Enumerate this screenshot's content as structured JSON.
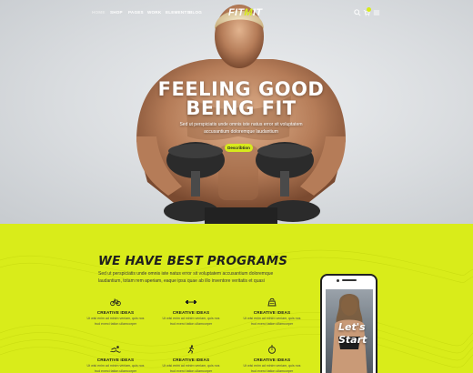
{
  "nav": {
    "links": [
      "HOME",
      "SHOP",
      "PAGES",
      "WORK",
      "ELEMENTS",
      "BLOG"
    ],
    "logo_main": "FIT",
    "logo_accent": "M",
    "logo_end": "IT"
  },
  "hero": {
    "title_line1": "FEELING GOOD",
    "title_line2": "BEING FIT",
    "subtitle": "Sed ut perspiciatis unde omnis iste natus error sit voluptatem accusantium doloremque laudantium",
    "button": "Describtion"
  },
  "programs": {
    "title": "WE HAVE BEST PROGRAMS",
    "description": "Sed ut perspiciatis unde omnis iste natus error sit voluptatem accusantium doloremque laudantium, totam rem aperiam, eaque ipsa quae ab illo inventore veritatis et quasi",
    "features": [
      {
        "icon": "bicycle-icon",
        "title": "CREATIVE IDEAS",
        "text": "Ut wisi enim ad minim veniam, quis nos trud exerci tation ullamcorper"
      },
      {
        "icon": "dumbbell-icon",
        "title": "CREATIVE IDEAS",
        "text": "Ut wisi enim ad minim veniam, quis nos trud exerci tation ullamcorper"
      },
      {
        "icon": "kettlebell-icon",
        "title": "CREATIVE IDEAS",
        "text": "Ut wisi enim ad minim veniam, quis nos trud exerci tation ullamcorper"
      },
      {
        "icon": "swimming-icon",
        "title": "CREATIVE IDEAS",
        "text": "Ut wisi enim ad minim veniam, quis nos trud exerci tation ullamcorper"
      },
      {
        "icon": "running-icon",
        "title": "CREATIVE IDEAS",
        "text": "Ut wisi enim ad minim veniam, quis nos trud exerci tation ullamcorper"
      },
      {
        "icon": "stopwatch-icon",
        "title": "CREATIVE IDEAS",
        "text": "Ut wisi enim ad minim veniam, quis nos trud exerci tation ullamcorper"
      }
    ],
    "phone_line1": "Let's",
    "phone_line2": "Start"
  },
  "colors": {
    "accent": "#d7ea1c",
    "dark": "#1f1f1f",
    "hero_bg": "#d9dcdf"
  }
}
